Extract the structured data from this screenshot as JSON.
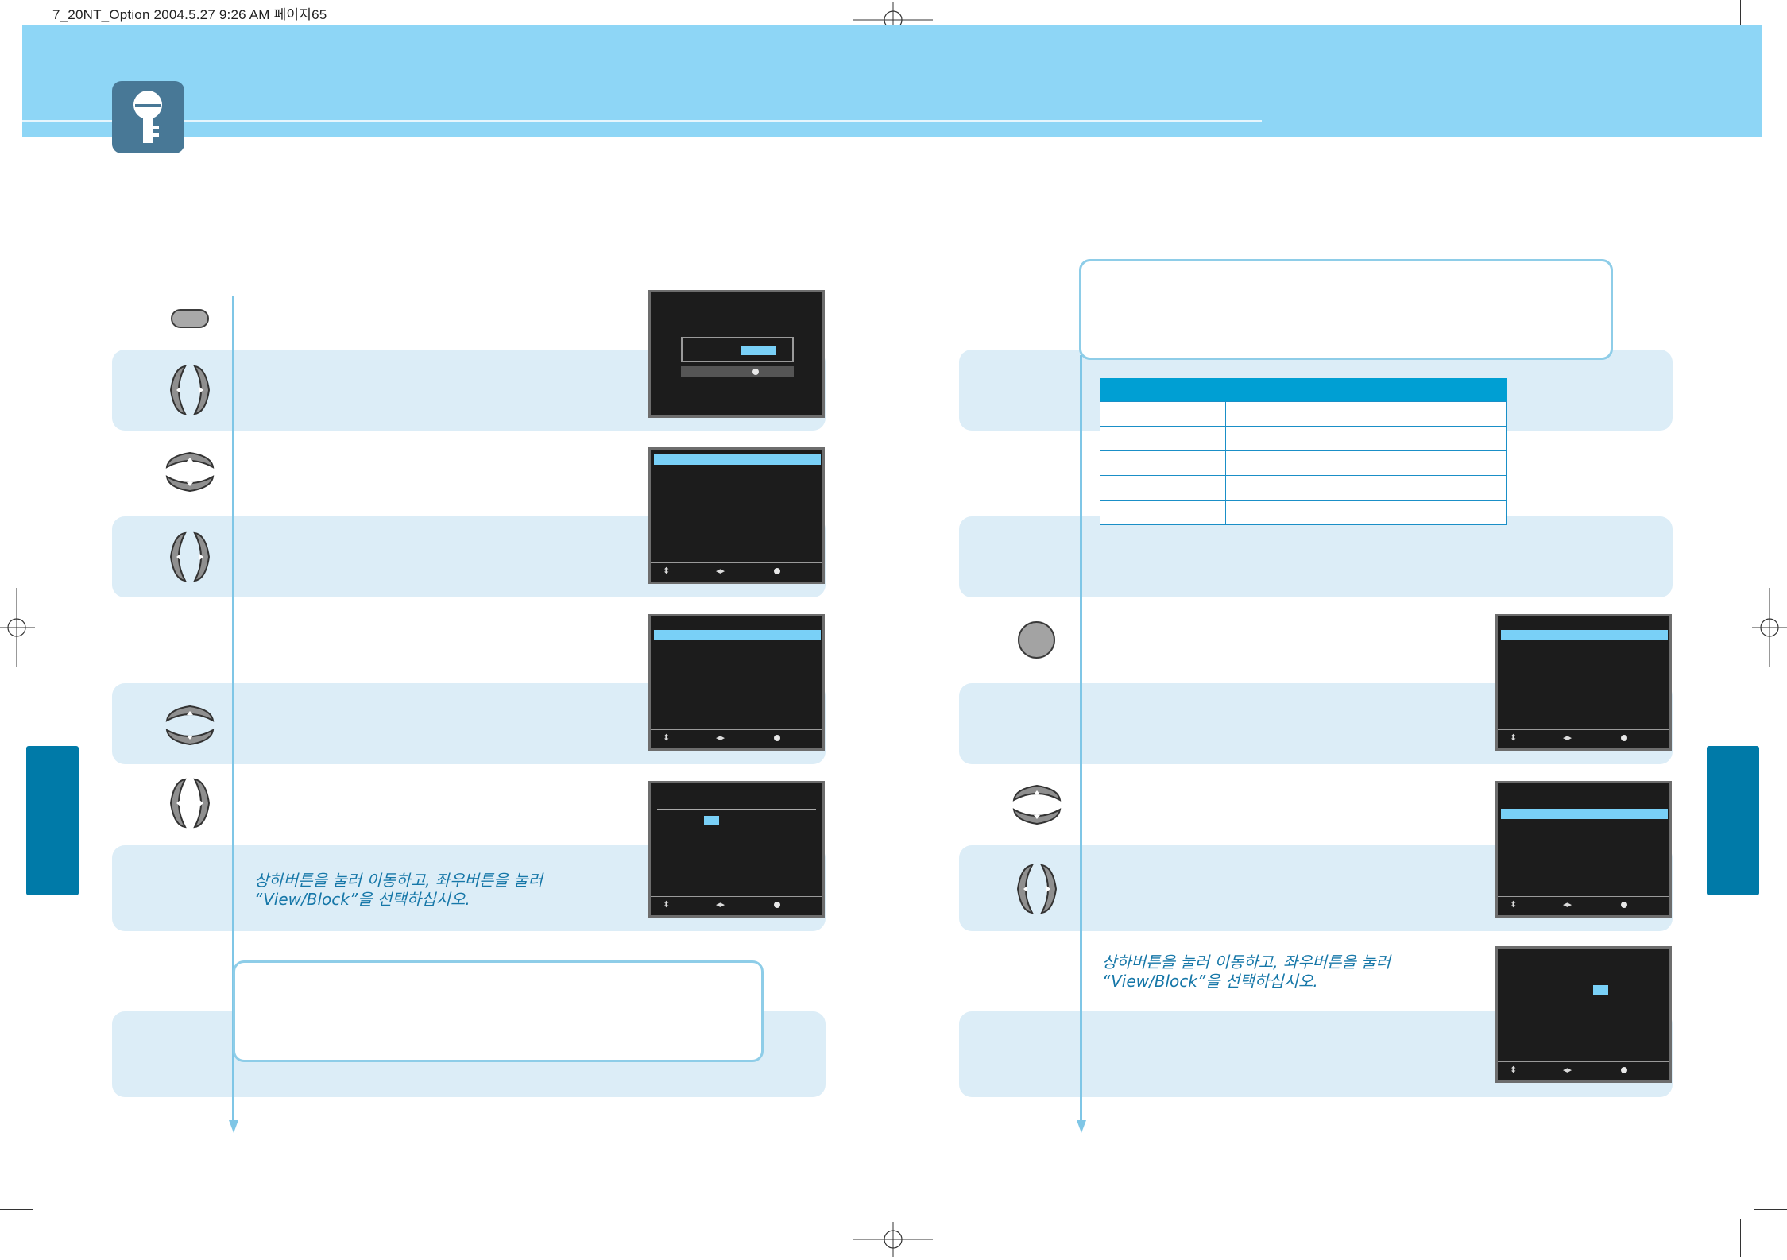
{
  "header": {
    "file_info": "7_20NT_Option  2004.5.27 9:26 AM 페이지65"
  },
  "instructions": {
    "left_view_block": "상하버튼을 눌러 이동하고, 좌우버튼을 눌러",
    "left_view_block_2": "“View/Block”을 선택하십시오.",
    "right_view_block": "상하버튼을 눌러 이동하고, 좌우버튼을 눌러",
    "right_view_block_2": "“View/Block”을 선택하십시오."
  },
  "icons": {
    "badge": "key-icon",
    "menu_button": "oval-button-icon",
    "left_right": "left-right-arrows-icon",
    "up_down": "up-down-arrows-icon",
    "enter_button": "round-button-icon"
  },
  "colors": {
    "banner": "#8ed6f6",
    "badge": "#487896",
    "band": "#dcedf7",
    "flow_line": "#7fc6e6",
    "table_header": "#009fd3",
    "side_tab": "#007aa8",
    "screen_highlight": "#79d0f7",
    "screen_bg": "#1c1c1c"
  }
}
